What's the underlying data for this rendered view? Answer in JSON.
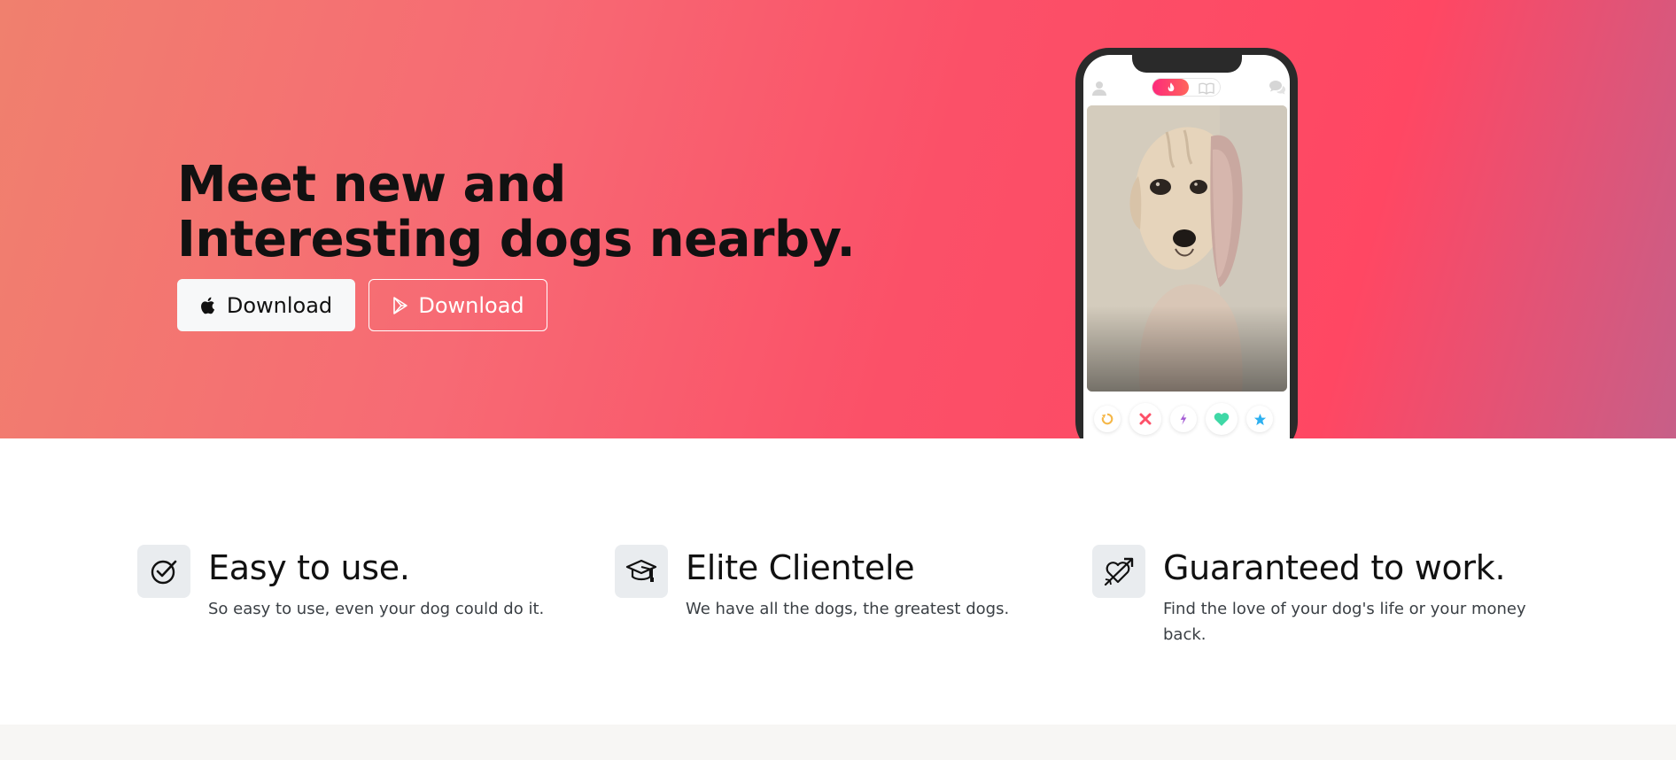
{
  "hero": {
    "title_line1": "Meet new and",
    "title_line2": "Interesting dogs nearby.",
    "btn_apple_label": "Download",
    "btn_play_label": "Download"
  },
  "phone": {
    "toggle_active_icon": "flame-icon",
    "toggle_inactive_icon": "book-icon",
    "profile_icon": "user-icon",
    "chat_icon": "chat-bubbles-icon",
    "actions": [
      "rewind-icon",
      "nope-icon",
      "boost-icon",
      "like-icon",
      "superlike-icon"
    ],
    "colors": {
      "rewind": "#f5b748",
      "nope": "#fd5068",
      "boost": "#a35ad4",
      "like": "#3fd8a6",
      "superlike": "#2db0f0"
    }
  },
  "features": [
    {
      "icon": "check-circle-icon",
      "title": "Easy to use.",
      "text": "So easy to use, even your dog could do it."
    },
    {
      "icon": "graduation-cap-icon",
      "title": "Elite Clientele",
      "text": "We have all the dogs, the greatest dogs."
    },
    {
      "icon": "heart-arrow-icon",
      "title": "Guaranteed to work.",
      "text": "Find the love of your dog's life or your money back."
    }
  ],
  "colors": {
    "hero_gradient_start": "#f0806e",
    "hero_gradient_mid": "#ff4763",
    "hero_gradient_end": "#c75f88",
    "text_dark": "#111111",
    "icon_box": "#e9ecef"
  }
}
